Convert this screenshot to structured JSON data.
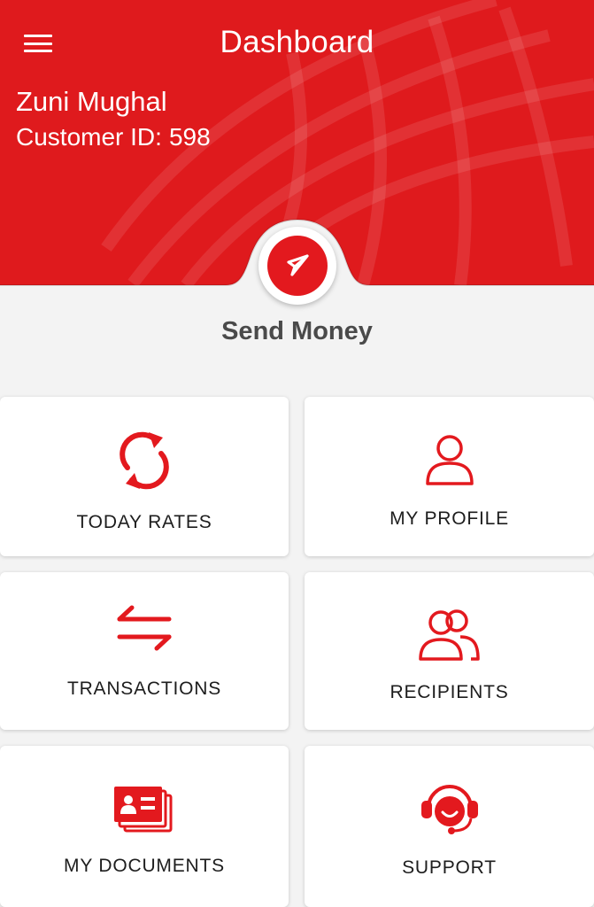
{
  "header": {
    "title": "Dashboard",
    "user_name": "Zuni Mughal",
    "customer_id_label": "Customer ID:",
    "customer_id_value": "598"
  },
  "send_money": {
    "label": "Send Money"
  },
  "tiles": [
    {
      "label": "TODAY RATES",
      "icon": "refresh-icon"
    },
    {
      "label": "MY PROFILE",
      "icon": "user-icon"
    },
    {
      "label": "TRANSACTIONS",
      "icon": "swap-arrows-icon"
    },
    {
      "label": "RECIPIENTS",
      "icon": "users-icon"
    },
    {
      "label": "MY DOCUMENTS",
      "icon": "id-card-icon"
    },
    {
      "label": "SUPPORT",
      "icon": "headset-icon"
    }
  ],
  "colors": {
    "brand_red": "#df1a1d",
    "background": "#f3f3f3"
  }
}
